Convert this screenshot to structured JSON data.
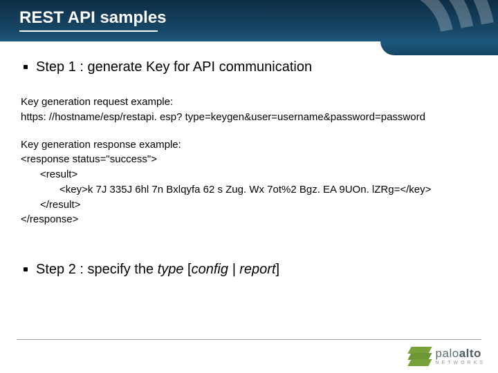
{
  "header": {
    "title": "REST API samples"
  },
  "step1": {
    "text": "Step 1 : generate Key for API communication"
  },
  "request": {
    "label": "Key  generation request example:",
    "url": "https: //hostname/esp/restapi. esp? type=keygen&user=username&password=password"
  },
  "response": {
    "label": "Key generation response example:",
    "line1": "<response status=\"success\">",
    "line2": "<result>",
    "line3": "<key>k 7J 335J 6hl 7n Bxlqyfa 62 s Zug. Wx 7ot%2 Bgz. EA 9UOn. lZRg=</key>",
    "line4": "</result>",
    "line5": "</response>"
  },
  "step2": {
    "prefix": "Step 2 : specify the ",
    "type_word": "type",
    "mid": " [",
    "opts": "config | report",
    "suffix": "]"
  },
  "logo": {
    "brand_light": "palo",
    "brand_bold": "alto",
    "sub": "NETWORKS"
  }
}
